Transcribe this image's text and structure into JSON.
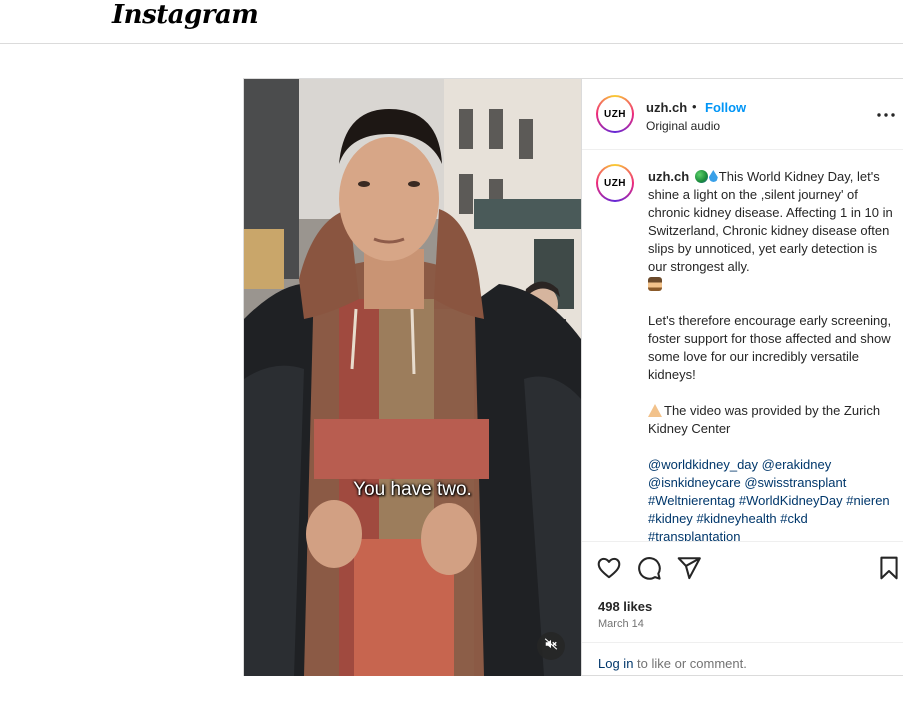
{
  "app": {
    "logo_text": "Instagram"
  },
  "video": {
    "subtitle": "You have two.",
    "mute_icon": "speaker-muted-icon"
  },
  "header": {
    "avatar_text": "UZH",
    "username": "uzh.ch",
    "separator": "•",
    "follow_label": "Follow",
    "audio_label": "Original audio",
    "more_icon": "more-options-icon"
  },
  "caption": {
    "avatar_text": "UZH",
    "username": "uzh.ch",
    "paragraph1": "This World Kidney Day, let's shine a light on the ,silent journey' of chronic kidney disease. Affecting 1 in 10 in Switzerland, Chronic kidney disease often slips by unnoticed, yet early detection is our strongest ally.",
    "paragraph2": "Let's therefore encourage early screening, foster support for those affected and show some love for our incredibly versatile kidneys!",
    "paragraph3": "The video was provided by the Zurich Kidney Center",
    "tags": [
      "@worldkidney_day",
      "@erakidney",
      "@isnkidneycare",
      "@swisstransplant",
      "#Weltnierentag",
      "#WorldKidneyDay",
      "#nieren",
      "#kidney",
      "#kidneyhealth",
      "#ckd",
      "#transplantation"
    ]
  },
  "actions": {
    "like_icon": "heart-icon",
    "comment_icon": "comment-icon",
    "share_icon": "share-icon",
    "save_icon": "bookmark-icon",
    "likes_text": "498 likes",
    "date_text": "March 14"
  },
  "footer": {
    "login_link": "Log in",
    "login_suffix": " to like or comment."
  },
  "colors": {
    "follow_blue": "#0095f6",
    "link_blue": "#00376b",
    "border": "#dbdbdb"
  }
}
